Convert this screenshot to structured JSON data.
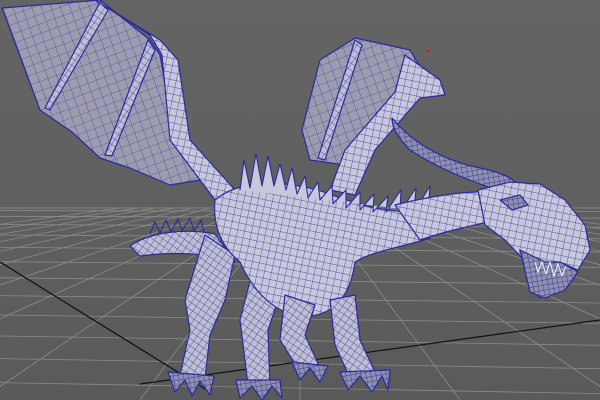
{
  "viewport": {
    "background_color": "#5e5e5e",
    "grid_color": "#9a9a9a",
    "axis_color": "#111111",
    "wireframe_color": "#2a2a9e",
    "mesh_fill_color": "#c4c4d6",
    "wing_fill_color": "#9a9aa8",
    "subject": "dragon-wireframe-mesh"
  }
}
